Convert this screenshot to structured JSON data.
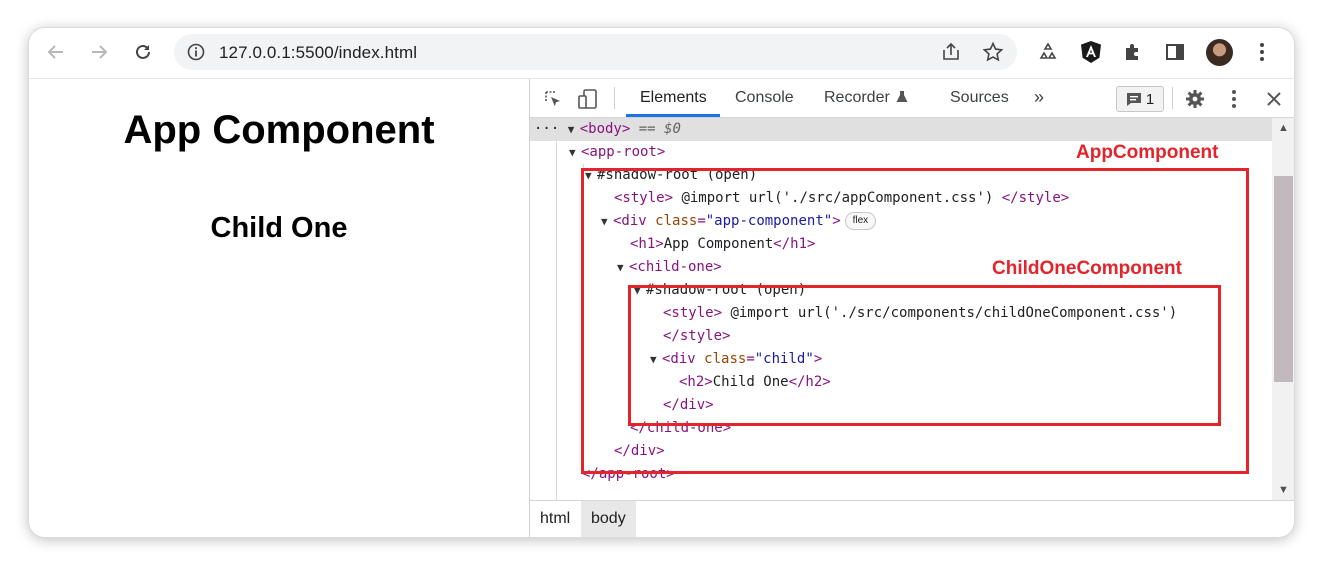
{
  "browser": {
    "url": "127.0.0.1:5500/index.html",
    "icons": {
      "back": "arrow-left-icon",
      "forward": "arrow-right-icon",
      "reload": "reload-icon",
      "site_info": "info-icon",
      "share": "share-icon",
      "bookmark": "star-icon",
      "extension_recycle": "recycle-icon",
      "extension_angular": "angular-icon",
      "extensions": "puzzle-icon",
      "side_panel": "side-panel-icon",
      "menu": "kebab-menu-icon"
    }
  },
  "page": {
    "h1": "App Component",
    "h2": "Child One"
  },
  "devtools": {
    "tabs": [
      "Elements",
      "Console",
      "Recorder",
      "Sources"
    ],
    "more_tabs": "»",
    "issues_count": "1",
    "dom_lines": {
      "body_open": "<body>",
      "body_eq": "== $0",
      "app_root_open": "<app-root>",
      "shadow_root_1": "#shadow-root (open)",
      "style1_open": "<style>",
      "style1_text": " @import url('./src/appComponent.css') ",
      "style1_close": "</style>",
      "div_app_open_a": "<div ",
      "div_app_attr_name": "class",
      "div_app_attr_value": "\"app-component\"",
      "div_app_open_b": ">",
      "flex_badge": "flex",
      "h1_open": "<h1>",
      "h1_text": "App Component",
      "h1_close": "</h1>",
      "child_one_open": "<child-one>",
      "shadow_root_2": "#shadow-root (open)",
      "style2_open": "<style>",
      "style2_text": " @import url('./src/components/childOneComponent.css')",
      "style2_close": "</style>",
      "div_child_open_a": "<div ",
      "div_child_attr_name": "class",
      "div_child_attr_value": "\"child\"",
      "div_child_open_b": ">",
      "h2_open": "<h2>",
      "h2_text": "Child One",
      "h2_close": "</h2>",
      "div_child_close": "</div>",
      "child_one_close": "</child-one>",
      "div_app_close": "</div>",
      "app_root_close": "</app-root>"
    },
    "breadcrumbs": [
      "html",
      "body"
    ]
  },
  "annotations": {
    "app_component": "AppComponent",
    "child_one_component": "ChildOneComponent",
    "color": "#e3242b"
  }
}
